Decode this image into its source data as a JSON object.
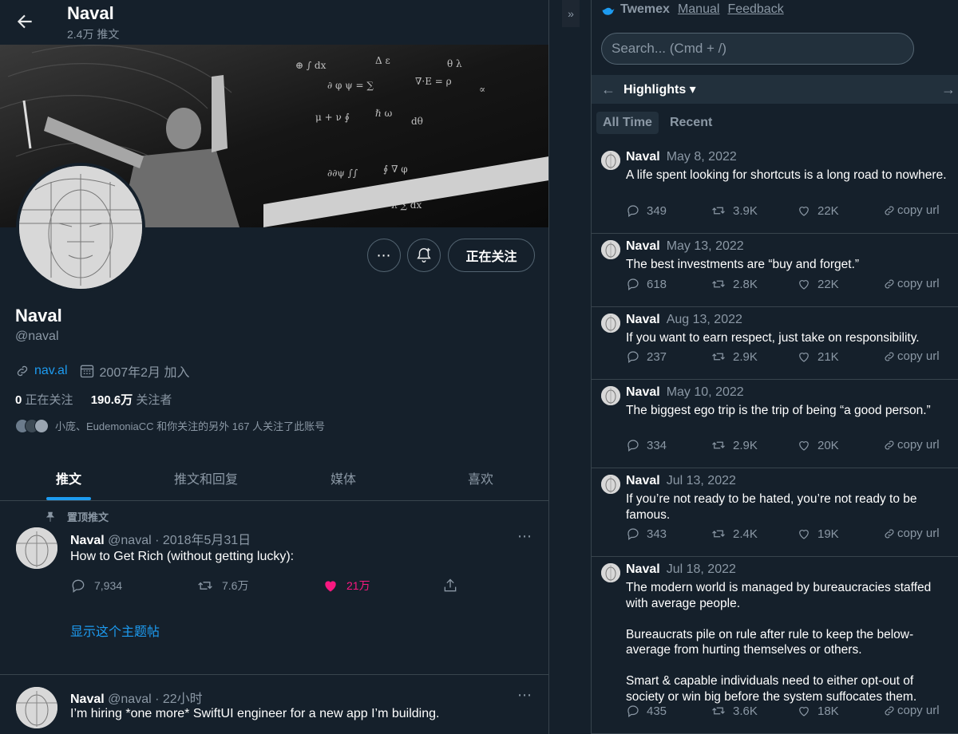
{
  "profile_header": {
    "name": "Naval",
    "tweet_count": "2.4万 推文"
  },
  "profile": {
    "name": "Naval",
    "handle": "@naval",
    "link": "nav.al",
    "joined": "2007年2月 加入",
    "following_count": "0",
    "following_label": "正在关注",
    "followers_count": "190.6万",
    "followers_label": "关注者",
    "followed_by": "小庞、EudemoniaCC 和你关注的另外 167 人关注了此账号",
    "follow_button": "正在关注"
  },
  "tabs": [
    {
      "label": "推文",
      "active": true
    },
    {
      "label": "推文和回复",
      "active": false
    },
    {
      "label": "媒体",
      "active": false
    },
    {
      "label": "喜欢",
      "active": false
    }
  ],
  "pinned_label": "置顶推文",
  "tweets": [
    {
      "name": "Naval",
      "meta": "@naval · 2018年5月31日",
      "text": "How to Get Rich (without getting lucky):",
      "replies": "7,934",
      "retweets": "7.6万",
      "likes": "21万",
      "liked": true,
      "thread_link": "显示这个主题帖"
    },
    {
      "name": "Naval",
      "meta": "@naval · 22小时",
      "text": "I’m hiring *one more* SwiftUI engineer for a new app I’m building."
    }
  ],
  "twemex": {
    "brand": "Twemex",
    "links": [
      "Manual",
      "Feedback"
    ],
    "search_placeholder": "Search... (Cmd + /)",
    "section_title": "Highlights ▾",
    "segments": [
      "All Time",
      "Recent"
    ],
    "active_segment": "All Time",
    "copy_label": "copy url",
    "items": [
      {
        "name": "Naval",
        "date": "May 8, 2022",
        "text": "A life spent looking for shortcuts is a long road to nowhere.",
        "replies": "349",
        "retweets": "3.9K",
        "likes": "22K"
      },
      {
        "name": "Naval",
        "date": "May 13, 2022",
        "text": "The best investments are “buy and forget.”",
        "replies": "618",
        "retweets": "2.8K",
        "likes": "22K"
      },
      {
        "name": "Naval",
        "date": "Aug 13, 2022",
        "text": "If you want to earn respect, just take on responsibility.",
        "replies": "237",
        "retweets": "2.9K",
        "likes": "21K"
      },
      {
        "name": "Naval",
        "date": "May 10, 2022",
        "text": "The biggest ego trip is the trip of being “a good person.”",
        "replies": "334",
        "retweets": "2.9K",
        "likes": "20K"
      },
      {
        "name": "Naval",
        "date": "Jul 13, 2022",
        "text": "If you’re not ready to be hated, you’re not ready to be famous.",
        "replies": "343",
        "retweets": "2.4K",
        "likes": "19K"
      },
      {
        "name": "Naval",
        "date": "Jul 18, 2022",
        "text": "The modern world is managed by bureaucracies staffed with average people.\n\nBureaucrats pile on rule after rule to keep the below-average from hurting themselves or others.\n\nSmart & capable individuals need to either opt-out of society or win big before the system suffocates them.",
        "replies": "435",
        "retweets": "3.6K",
        "likes": "18K"
      }
    ]
  },
  "colors": {
    "background": "#15202b",
    "accent": "#1d9bf0",
    "like": "#f91880",
    "muted": "#8b98a5"
  },
  "icons": [
    "back-arrow-icon",
    "more-icon",
    "bell-plus-icon",
    "link-icon",
    "calendar-icon",
    "pin-icon",
    "reply-icon",
    "retweet-icon",
    "heart-icon",
    "share-icon",
    "bird-icon",
    "chevron-right-icon"
  ]
}
